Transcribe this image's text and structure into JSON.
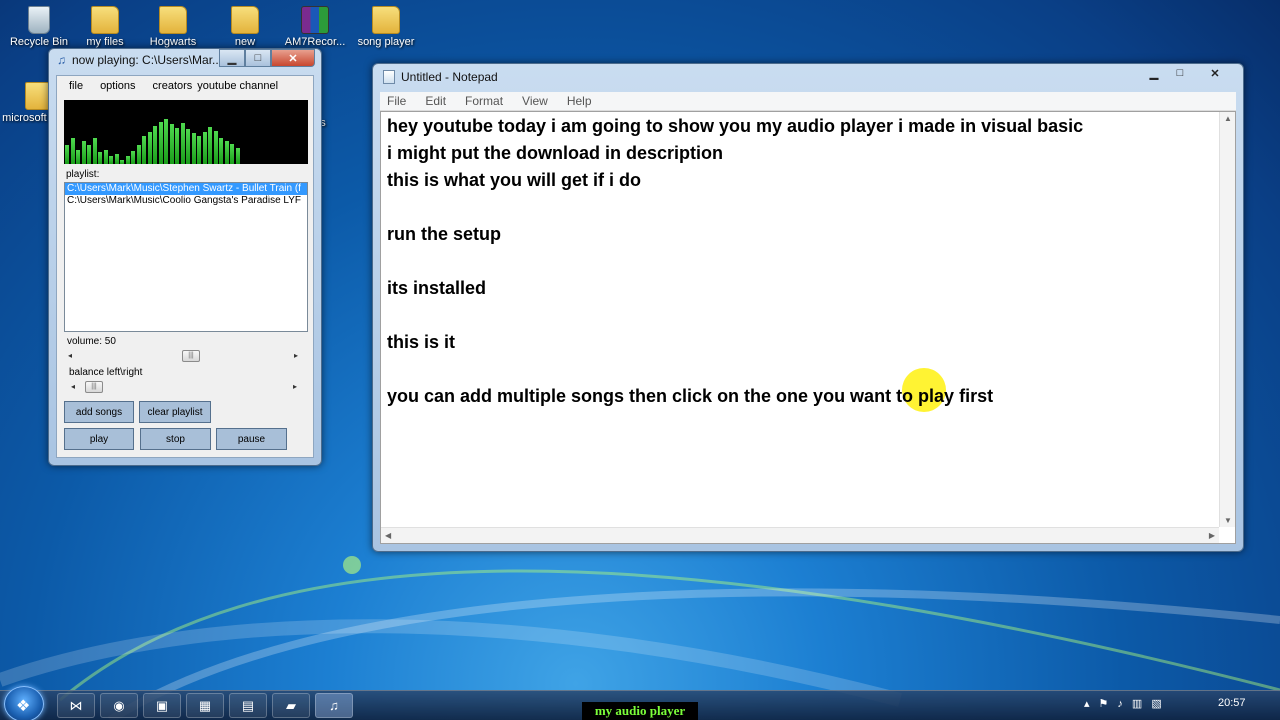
{
  "desktop": {
    "icons": [
      {
        "label": "Recycle Bin",
        "type": "bin"
      },
      {
        "label": "my files",
        "type": "folder"
      },
      {
        "label": "Hogwarts",
        "type": "folder"
      },
      {
        "label": "new",
        "type": "folder"
      },
      {
        "label": "AM7Recor...",
        "type": "winrar"
      },
      {
        "label": "song player",
        "type": "folder"
      },
      {
        "label": "microsoft office",
        "type": "folder"
      }
    ],
    "partial_text": "es"
  },
  "player": {
    "title": "now playing:  C:\\Users\\Mar...",
    "menu": [
      "file",
      "options",
      "creators",
      "youtube channel"
    ],
    "playlist_label": "playlist:",
    "playlist": [
      "C:\\Users\\Mark\\Music\\Stephen Swartz - Bullet Train (f",
      "C:\\Users\\Mark\\Music\\Coolio Gangsta's Paradise LYF"
    ],
    "selected_index": 0,
    "volume_label": "volume: 50",
    "volume_value": 50,
    "balance_label": "balance left\\right",
    "buttons": {
      "add": "add songs",
      "clear": "clear playlist",
      "play": "play",
      "stop": "stop",
      "pause": "pause"
    },
    "visualizer_levels": [
      0.3,
      0.4,
      0.22,
      0.36,
      0.3,
      0.4,
      0.18,
      0.22,
      0.12,
      0.16,
      0.06,
      0.12,
      0.2,
      0.3,
      0.44,
      0.5,
      0.6,
      0.66,
      0.7,
      0.62,
      0.56,
      0.64,
      0.54,
      0.48,
      0.44,
      0.5,
      0.58,
      0.52,
      0.4,
      0.36,
      0.32,
      0.25
    ]
  },
  "notepad": {
    "title": "Untitled - Notepad",
    "menu": [
      "File",
      "Edit",
      "Format",
      "View",
      "Help"
    ],
    "lines": [
      "hey youtube today i am going to show you my audio player i made in visual basic",
      "i might put the download in description",
      "this is what you will get if i do",
      "",
      "run the setup",
      "",
      "its installed",
      "",
      "this is it",
      "",
      "you can add multiple songs then click on the one you want to play first"
    ]
  },
  "taskbar": {
    "caption": "my audio player",
    "clock": "20:57"
  },
  "colors": {
    "accent": "#3399ff",
    "viz_green": "#1a9d1a",
    "caption_text": "#7cff3a"
  }
}
